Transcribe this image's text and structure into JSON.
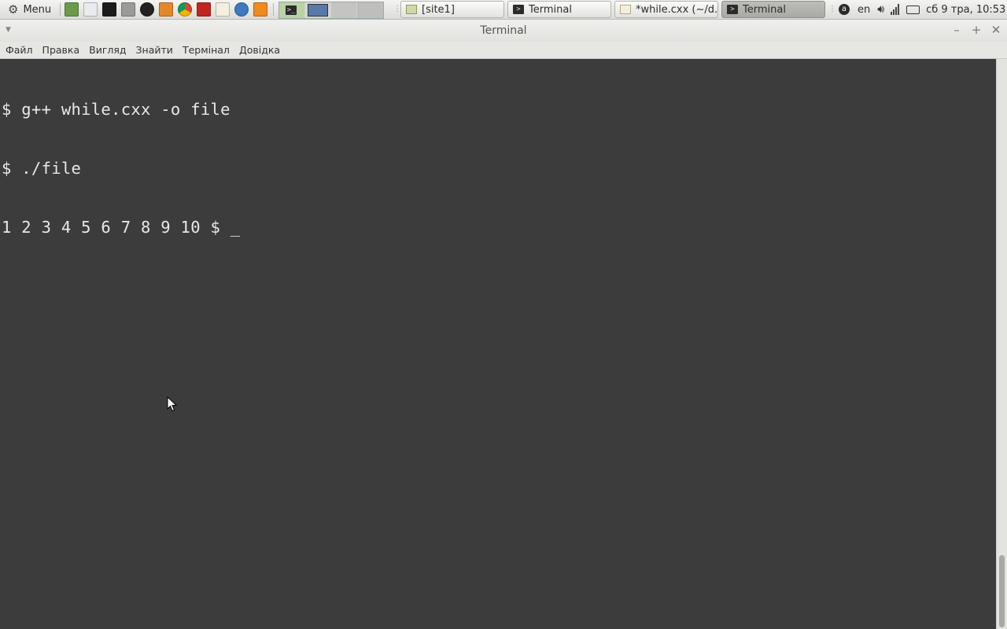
{
  "panel": {
    "menu_label": "Menu",
    "launchers": [
      "file-manager-icon",
      "text-editor-icon",
      "terminal-icon",
      "disk-icon",
      "audio-player-icon",
      "firefox-icon",
      "chrome-icon",
      "filezilla-icon",
      "notes-icon",
      "thunderbird-icon",
      "rss-icon"
    ],
    "tasks": [
      {
        "label": "[site1]"
      },
      {
        "label": "Terminal"
      },
      {
        "label": "*while.cxx (~/d..."
      },
      {
        "label": "Terminal"
      }
    ],
    "keyboard_layout": "en",
    "clock": "сб 9 тра, 10:53"
  },
  "window": {
    "title": "Terminal",
    "menu": [
      "Файл",
      "Правка",
      "Вигляд",
      "Знайти",
      "Термінал",
      "Довідка"
    ]
  },
  "terminal": {
    "lines": [
      "$ g++ while.cxx -o file",
      "$ ./file",
      "1 2 3 4 5 6 7 8 9 10 $ _"
    ]
  }
}
